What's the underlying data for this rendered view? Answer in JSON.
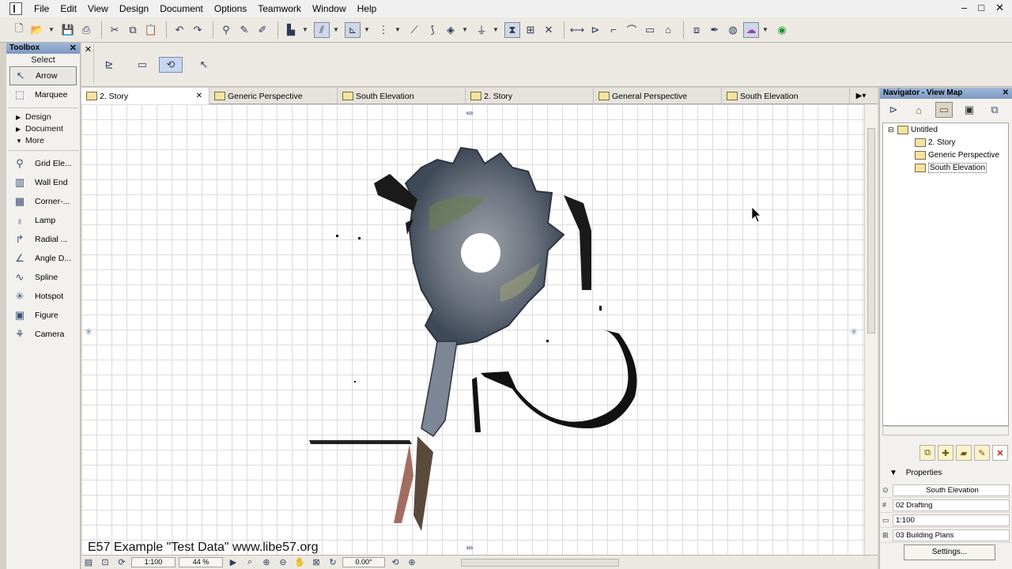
{
  "menubar": {
    "items": [
      "File",
      "Edit",
      "View",
      "Design",
      "Document",
      "Options",
      "Teamwork",
      "Window",
      "Help"
    ],
    "controls": [
      "–",
      "□",
      "✕"
    ]
  },
  "toolbox": {
    "title": "Toolbox",
    "close": "✕",
    "select_label": "Select",
    "tools_top": [
      {
        "label": "Arrow",
        "icon": "arrow-pointer-icon",
        "glyph": "↖",
        "selected": true
      },
      {
        "label": "Marquee",
        "icon": "marquee-icon",
        "glyph": "⬚",
        "selected": false
      }
    ],
    "groups": [
      {
        "label": "Design",
        "expanded": false
      },
      {
        "label": "Document",
        "expanded": false
      },
      {
        "label": "More",
        "expanded": true
      }
    ],
    "tools_more": [
      {
        "label": "Grid Ele...",
        "icon": "grid-element-icon",
        "glyph": "⚲"
      },
      {
        "label": "Wall End",
        "icon": "wall-end-icon",
        "glyph": "▥"
      },
      {
        "label": "Corner-...",
        "icon": "corner-window-icon",
        "glyph": "▦"
      },
      {
        "label": "Lamp",
        "icon": "lamp-icon",
        "glyph": "♁"
      },
      {
        "label": "Radial ...",
        "icon": "radial-dimension-icon",
        "glyph": "↱"
      },
      {
        "label": "Angle D...",
        "icon": "angle-dimension-icon",
        "glyph": "∠"
      },
      {
        "label": "Spline",
        "icon": "spline-icon",
        "glyph": "∿"
      },
      {
        "label": "Hotspot",
        "icon": "hotspot-icon",
        "glyph": "✳"
      },
      {
        "label": "Figure",
        "icon": "figure-icon",
        "glyph": "▣"
      },
      {
        "label": "Camera",
        "icon": "camera-icon",
        "glyph": "⚘"
      }
    ]
  },
  "tabs": [
    {
      "label": "2. Story",
      "active": true,
      "closable": true
    },
    {
      "label": "Generic Perspective",
      "active": false,
      "closable": false
    },
    {
      "label": "South Elevation",
      "active": false,
      "closable": false
    },
    {
      "label": "2. Story",
      "active": false,
      "closable": false
    },
    {
      "label": "General Perspective",
      "active": false,
      "closable": false
    },
    {
      "label": "South Elevation",
      "active": false,
      "closable": false
    }
  ],
  "canvas": {
    "watermark": "E57 Example \"Test Data\" www.libe57.org"
  },
  "statusbar": {
    "scale": "1:100",
    "zoom": "44 %",
    "angle": "0.00°"
  },
  "navigator": {
    "title": "Navigator - View Map",
    "close": "✕",
    "tree": [
      {
        "label": "Untitled",
        "level": 0,
        "selected": false
      },
      {
        "label": "2. Story",
        "level": 1,
        "selected": false
      },
      {
        "label": "Generic Perspective",
        "level": 1,
        "selected": false
      },
      {
        "label": "South Elevation",
        "level": 1,
        "selected": true
      }
    ],
    "properties_label": "Properties",
    "properties": {
      "name": "South Elevation",
      "layer_combination": "02 Drafting",
      "scale": "1:100",
      "model_view": "03 Building Plans"
    },
    "settings_button": "Settings..."
  },
  "colors": {
    "accent_title": "#7e98c2",
    "canvas_bg": "#ffffff",
    "grid": "#dcdcdc",
    "chrome": "#ece9e2"
  }
}
